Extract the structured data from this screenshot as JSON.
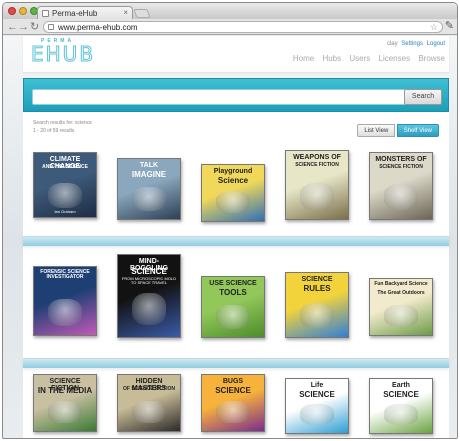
{
  "browser": {
    "tab_title": "Perma-eHub",
    "tab_close": "×",
    "url": "www.perma-ehub.com",
    "back": "←",
    "forward": "→",
    "reload": "↻",
    "star": "☆",
    "wrench": "✎"
  },
  "header": {
    "logo_small": "PERMA",
    "logo_big": "EHUB",
    "user": "clay",
    "settings": "Settings",
    "logout": "Logout",
    "nav": [
      "Home",
      "Hubs",
      "Users",
      "Licenses",
      "Browse"
    ]
  },
  "search": {
    "value": "",
    "placeholder": "",
    "button": "Search"
  },
  "results": {
    "line1": "Search results for: science",
    "line2": "1 - 20 of 59 results",
    "list_view": "List View",
    "shelf_view": "Shelf View"
  },
  "books": [
    {
      "title": "CLIMATE CHANGE",
      "sub": "AND THE SCIENCE",
      "author": "Ian Graham",
      "colors": [
        "#3e5a7a",
        "#1d2d44"
      ]
    },
    {
      "title": "TALK",
      "sub": "IMAGINE",
      "colors": [
        "#8aa7bd",
        "#2c3f55"
      ]
    },
    {
      "title": "Playground",
      "sub": "Science",
      "colors": [
        "#f0d85a",
        "#2f6fb7"
      ]
    },
    {
      "title": "WEAPONS OF",
      "sub": "SCIENCE FICTION",
      "colors": [
        "#e7e7c8",
        "#7a6f48"
      ]
    },
    {
      "title": "MONSTERS OF",
      "sub": "SCIENCE FICTION",
      "colors": [
        "#dcd9c9",
        "#6b6555"
      ]
    },
    {
      "title": "FORENSIC SCIENCE INVESTIGATOR",
      "sub": "",
      "colors": [
        "#1e3f74",
        "#c25ab7"
      ]
    },
    {
      "title": "MIND-BOGGLING",
      "sub": "SCIENCE",
      "tag": "FROM MICROSCOPIC MOLD TO SPACE TRAVEL",
      "colors": [
        "#121212",
        "#3b5aa8"
      ]
    },
    {
      "title": "USE SCIENCE",
      "sub": "TOOLS",
      "colors": [
        "#92c85a",
        "#4c8c2a"
      ]
    },
    {
      "title": "SCIENCE",
      "sub": "RULES",
      "colors": [
        "#f2d33c",
        "#2f7fd8"
      ]
    },
    {
      "title": "Fun Backyard Science",
      "sub": "The Great Outdoors",
      "colors": [
        "#f2eacc",
        "#6c9b46"
      ]
    },
    {
      "title": "SCIENCE FICTION",
      "sub": "IN THE MEDIA",
      "colors": [
        "#c9c0a2",
        "#3a7a34"
      ]
    },
    {
      "title": "HIDDEN MASTERS",
      "sub": "OF SCIENCE FICTION",
      "colors": [
        "#c8bc98",
        "#2d2a28"
      ]
    },
    {
      "title": "BUGS",
      "sub": "SCIENCE",
      "colors": [
        "#f7b23b",
        "#7a2c8e"
      ]
    },
    {
      "title": "Life",
      "sub": "SCIENCE",
      "colors": [
        "#ffffff",
        "#2b9ed2"
      ]
    },
    {
      "title": "Earth",
      "sub": "SCIENCE",
      "colors": [
        "#ffffff",
        "#6aa33e"
      ]
    }
  ]
}
